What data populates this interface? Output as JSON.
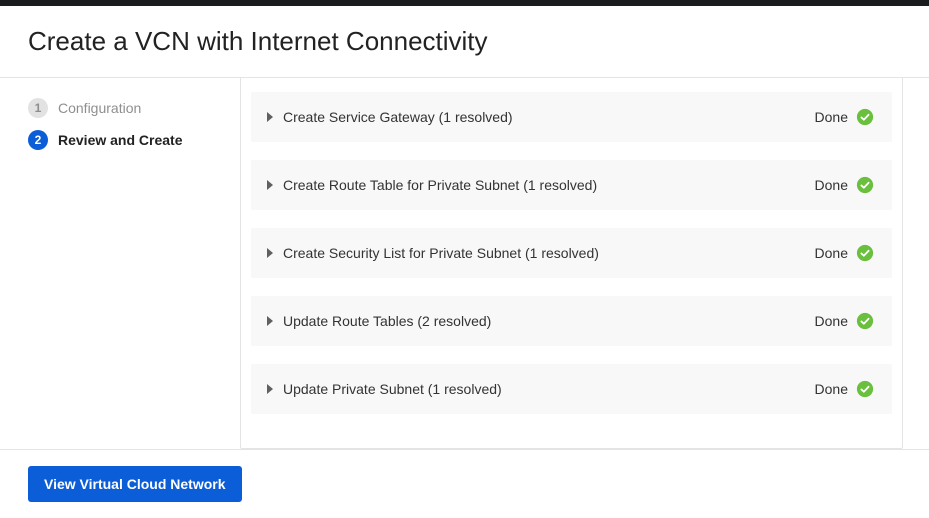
{
  "header": {
    "title": "Create a VCN with Internet Connectivity"
  },
  "steps": [
    {
      "num": "1",
      "label": "Configuration",
      "state": "inactive"
    },
    {
      "num": "2",
      "label": "Review and Create",
      "state": "active"
    }
  ],
  "tasks": [
    {
      "title": "Create Service Gateway (1 resolved)",
      "status": "Done"
    },
    {
      "title": "Create Route Table for Private Subnet (1 resolved)",
      "status": "Done"
    },
    {
      "title": "Create Security List for Private Subnet (1 resolved)",
      "status": "Done"
    },
    {
      "title": "Update Route Tables (2 resolved)",
      "status": "Done"
    },
    {
      "title": "Update Private Subnet (1 resolved)",
      "status": "Done"
    }
  ],
  "footer": {
    "primary_button": "View Virtual Cloud Network"
  },
  "colors": {
    "accent": "#0b5ed7",
    "success": "#6bbf3f"
  }
}
